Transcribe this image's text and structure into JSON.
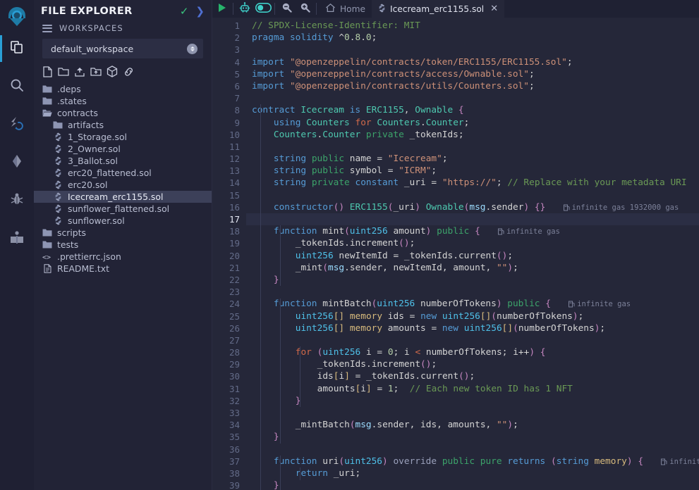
{
  "rail": {
    "logo": "remix-logo",
    "items": [
      {
        "name": "file-explorer",
        "icon": "files-icon",
        "active": true
      },
      {
        "name": "search",
        "icon": "search-icon",
        "active": false
      },
      {
        "name": "solidity-compiler",
        "icon": "compiler-icon",
        "active": false
      },
      {
        "name": "deploy-run",
        "icon": "ethereum-icon",
        "active": false
      },
      {
        "name": "debugger",
        "icon": "bug-icon",
        "active": false
      },
      {
        "name": "plugin-manager",
        "icon": "book-icon",
        "active": false
      }
    ]
  },
  "explorer": {
    "title": "FILE EXPLORER",
    "check_icon": "check-icon",
    "chevron_icon": "chevron-right-icon",
    "workspaces_label": "WORKSPACES",
    "workspace_selected": "default_workspace",
    "actions": [
      {
        "name": "create-new-file",
        "icon": "new-file-icon"
      },
      {
        "name": "create-new-folder",
        "icon": "new-folder-icon"
      },
      {
        "name": "publish-to-gist",
        "icon": "upload-icon"
      },
      {
        "name": "upload-folder",
        "icon": "upload-folder-icon"
      },
      {
        "name": "publish-workspace",
        "icon": "box-icon"
      },
      {
        "name": "connect-to-localhost",
        "icon": "link-icon"
      }
    ],
    "tree": [
      {
        "label": ".deps",
        "icon": "folder-icon",
        "indent": 0,
        "selected": false
      },
      {
        "label": ".states",
        "icon": "folder-icon",
        "indent": 0,
        "selected": false
      },
      {
        "label": "contracts",
        "icon": "folder-open-icon",
        "indent": 0,
        "selected": false
      },
      {
        "label": "artifacts",
        "icon": "folder-icon",
        "indent": 1,
        "selected": false
      },
      {
        "label": "1_Storage.sol",
        "icon": "solidity-file-icon",
        "indent": 1,
        "selected": false
      },
      {
        "label": "2_Owner.sol",
        "icon": "solidity-file-icon",
        "indent": 1,
        "selected": false
      },
      {
        "label": "3_Ballot.sol",
        "icon": "solidity-file-icon",
        "indent": 1,
        "selected": false
      },
      {
        "label": "erc20_flattened.sol",
        "icon": "solidity-file-icon",
        "indent": 1,
        "selected": false
      },
      {
        "label": "erc20.sol",
        "icon": "solidity-file-icon",
        "indent": 1,
        "selected": false
      },
      {
        "label": "Icecream_erc1155.sol",
        "icon": "solidity-file-icon",
        "indent": 1,
        "selected": true
      },
      {
        "label": "sunflower_flattened.sol",
        "icon": "solidity-file-icon",
        "indent": 1,
        "selected": false
      },
      {
        "label": "sunflower.sol",
        "icon": "solidity-file-icon",
        "indent": 1,
        "selected": false
      },
      {
        "label": "scripts",
        "icon": "folder-icon",
        "indent": 0,
        "selected": false
      },
      {
        "label": "tests",
        "icon": "folder-icon",
        "indent": 0,
        "selected": false
      },
      {
        "label": ".prettierrc.json",
        "icon": "json-file-icon",
        "indent": 0,
        "selected": false
      },
      {
        "label": "README.txt",
        "icon": "text-file-icon",
        "indent": 0,
        "selected": false
      }
    ]
  },
  "toolbar": {
    "run_icon": "play-icon",
    "ai_icon": "robot-icon",
    "toggle_icon": "toggle-switch-icon",
    "zoom_out_icon": "zoom-out-icon",
    "zoom_in_icon": "zoom-in-icon",
    "home_label": "Home",
    "home_icon": "home-icon",
    "tab_label": "Icecream_erc1155.sol",
    "tab_icon": "solidity-file-icon",
    "tab_close_icon": "close-icon"
  },
  "editor": {
    "active_line": 17,
    "first_line": 1,
    "last_line": 39,
    "gas_annotations": {
      "line16": "infinite gas 1932000 gas",
      "line18": "infinite gas",
      "line24": "infinite gas",
      "line37": "infinite gas"
    },
    "lines": [
      "// SPDX-License-Identifier: MIT",
      "pragma solidity ^0.8.0;",
      "",
      "import \"@openzeppelin/contracts/token/ERC1155/ERC1155.sol\";",
      "import \"@openzeppelin/contracts/access/Ownable.sol\";",
      "import \"@openzeppelin/contracts/utils/Counters.sol\";",
      "",
      "contract Icecream is ERC1155, Ownable {",
      "    using Counters for Counters.Counter;",
      "    Counters.Counter private _tokenIds;",
      "",
      "    string public name = \"Icecream\";",
      "    string public symbol = \"ICRM\";",
      "    string private constant _uri = \"https://\"; // Replace with your metadata URI",
      "",
      "    constructor() ERC1155(_uri) Ownable(msg.sender) {}",
      "",
      "    function mint(uint256 amount) public {",
      "        _tokenIds.increment();",
      "        uint256 newItemId = _tokenIds.current();",
      "        _mint(msg.sender, newItemId, amount, \"\");",
      "    }",
      "",
      "    function mintBatch(uint256 numberOfTokens) public {",
      "        uint256[] memory ids = new uint256[](numberOfTokens);",
      "        uint256[] memory amounts = new uint256[](numberOfTokens);",
      "",
      "        for (uint256 i = 0; i < numberOfTokens; i++) {",
      "            _tokenIds.increment();",
      "            ids[i] = _tokenIds.current();",
      "            amounts[i] = 1;  // Each new token ID has 1 NFT",
      "        }",
      "",
      "        _mintBatch(msg.sender, ids, amounts, \"\");",
      "    }",
      "",
      "    function uri(uint256) override public pure returns (string memory) {",
      "        return _uri;",
      "    }"
    ]
  },
  "colors": {
    "background": "#252739",
    "panel": "#222336",
    "rail": "#1f2033",
    "selection": "#3c4059",
    "accent_blue": "#2a9fd6",
    "accent_green": "#3ac47d",
    "accent_teal": "#4ec9b0",
    "comment": "#6a9955",
    "keyword": "#569cd6",
    "string": "#ce9178",
    "modifier": "#3ca36a"
  }
}
